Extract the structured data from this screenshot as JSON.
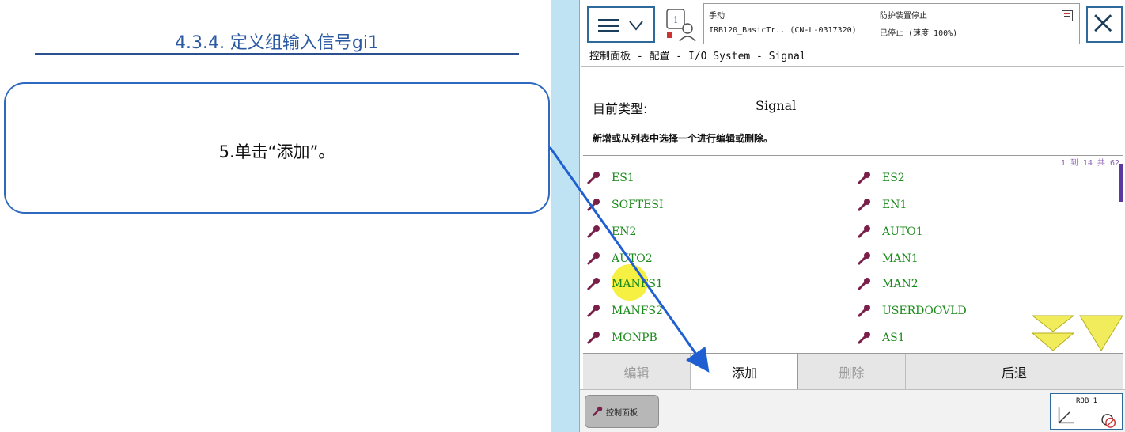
{
  "slide": {
    "title": "4.3.4. 定义组输入信号gi1",
    "callout": "5.单击“添加”。"
  },
  "pendant": {
    "status": {
      "mode": "手动",
      "controller": "IRB120_BasicTr.. (CN-L-0317320)",
      "safety": "防护装置停止",
      "state": "已停止 (速度 100%)"
    },
    "breadcrumb": "控制面板 - 配置 - I/O System - Signal",
    "current_type_label": "目前类型:",
    "current_type_value": "Signal",
    "instruction": "新增或从列表中选择一个进行编辑或删除。",
    "page_count": "1 到 14 共 62",
    "signals_left": [
      "ES1",
      "SOFTESI",
      "EN2",
      "AUTO2",
      "MANFS1",
      "MANFS2",
      "MONPB"
    ],
    "signals_right": [
      "ES2",
      "EN1",
      "AUTO1",
      "MAN1",
      "MAN2",
      "USERDOOVLD",
      "AS1"
    ],
    "actions": {
      "edit": "编辑",
      "add": "添加",
      "delete": "删除",
      "back": "后退"
    },
    "taskbar_tab": "控制面板",
    "robot_label": "ROB_1"
  },
  "colors": {
    "signal_text": "#1b8a1b",
    "callout_border": "#2e68c0",
    "title_blue": "#2b5aa3",
    "arrow": "#1f5fd1"
  }
}
